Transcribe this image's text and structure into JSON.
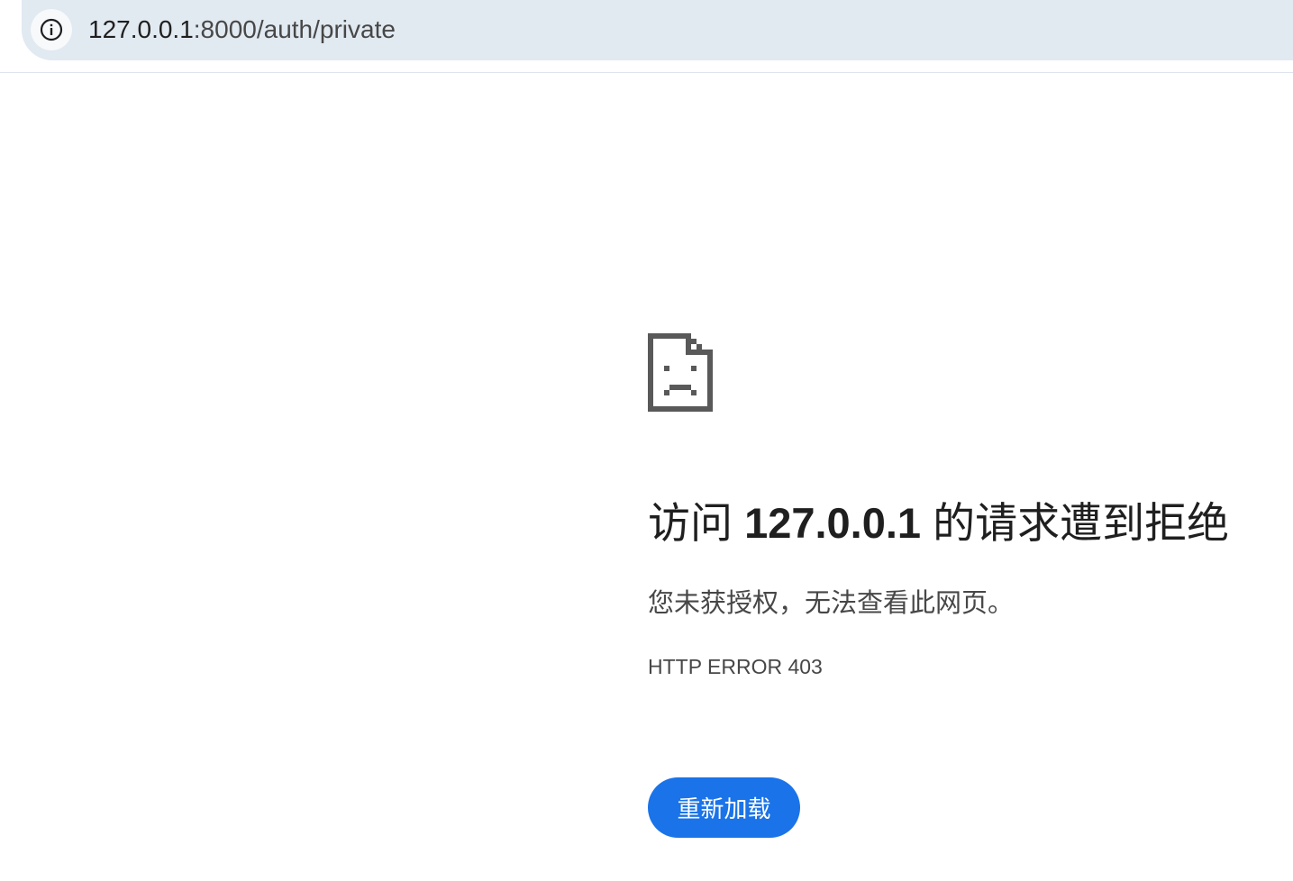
{
  "browser": {
    "url_host": "127.0.0.1",
    "url_path": ":8000/auth/private",
    "site_info_icon": "info-circle-icon"
  },
  "error_page": {
    "icon": "sad-document-icon",
    "headline_prefix": "访问 ",
    "headline_host": "127.0.0.1",
    "headline_suffix": " 的请求遭到拒绝",
    "description": "您未获授权，无法查看此网页。",
    "error_code": "HTTP ERROR 403",
    "reload_button_label": "重新加载"
  },
  "colors": {
    "accent": "#1a73e8",
    "omnibox_bg": "#e1e9f1",
    "icon_gray": "#595959"
  }
}
